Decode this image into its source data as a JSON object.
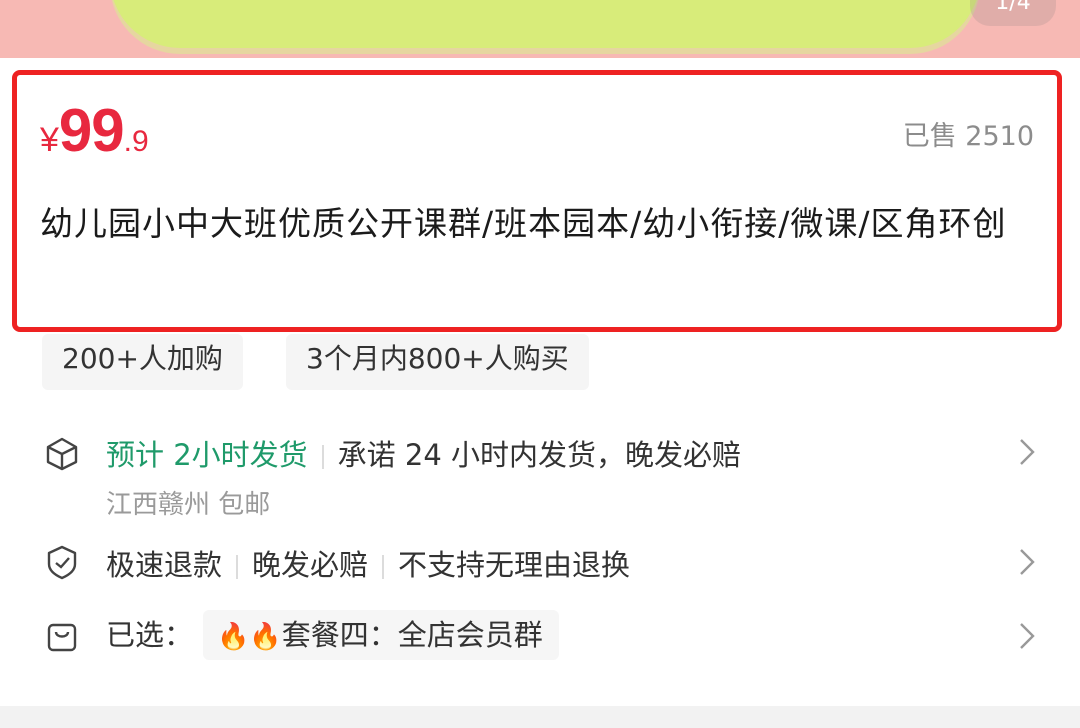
{
  "banner": {
    "counter": "1/4"
  },
  "product": {
    "currency": "¥",
    "price_int": "99",
    "price_dec": ".9",
    "sold": "已售 2510",
    "title": "幼儿园小中大班优质公开课群/班本园本/幼小衔接/微课/区角环创"
  },
  "tags": [
    "200+人加购",
    "3个月内800+人购买"
  ],
  "shipping": {
    "estimate": "预计 2小时发货",
    "promise": "承诺 24 小时内发货，晚发必赔",
    "location": "江西赣州 包邮"
  },
  "service": {
    "items": [
      "极速退款",
      "晚发必赔",
      "不支持无理由退换"
    ]
  },
  "selection": {
    "label": "已选：",
    "fire_icons": "🔥🔥",
    "option": "套餐四：全店会员群"
  },
  "colors": {
    "price": "#e8283f",
    "green": "#1f9a6a",
    "highlight_border": "#ee2222"
  },
  "icons": [
    "truck-box-icon",
    "shield-check-icon",
    "bag-icon",
    "chevron-right-icon",
    "fire-icon"
  ]
}
